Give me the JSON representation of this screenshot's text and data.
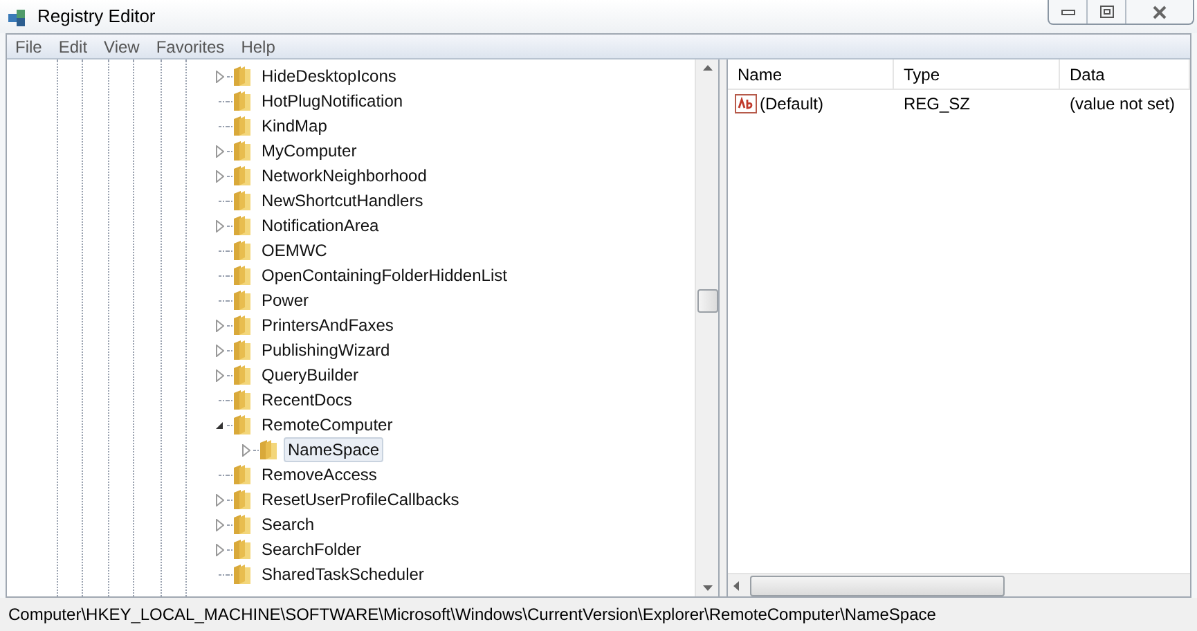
{
  "window": {
    "title": "Registry Editor"
  },
  "menu": [
    "File",
    "Edit",
    "View",
    "Favorites",
    "Help"
  ],
  "tree": [
    {
      "label": "HideDesktopIcons",
      "kind": "collapsed",
      "selected": false
    },
    {
      "label": "HotPlugNotification",
      "kind": "leaf",
      "selected": false
    },
    {
      "label": "KindMap",
      "kind": "leaf",
      "selected": false
    },
    {
      "label": "MyComputer",
      "kind": "collapsed",
      "selected": false
    },
    {
      "label": "NetworkNeighborhood",
      "kind": "collapsed",
      "selected": false
    },
    {
      "label": "NewShortcutHandlers",
      "kind": "leaf",
      "selected": false
    },
    {
      "label": "NotificationArea",
      "kind": "collapsed",
      "selected": false
    },
    {
      "label": "OEMWC",
      "kind": "leaf",
      "selected": false
    },
    {
      "label": "OpenContainingFolderHiddenList",
      "kind": "leaf",
      "selected": false
    },
    {
      "label": "Power",
      "kind": "leaf",
      "selected": false
    },
    {
      "label": "PrintersAndFaxes",
      "kind": "collapsed",
      "selected": false
    },
    {
      "label": "PublishingWizard",
      "kind": "collapsed",
      "selected": false
    },
    {
      "label": "QueryBuilder",
      "kind": "collapsed",
      "selected": false
    },
    {
      "label": "RecentDocs",
      "kind": "leaf",
      "selected": false
    },
    {
      "label": "RemoteComputer",
      "kind": "expanded",
      "selected": false,
      "children": [
        {
          "label": "NameSpace",
          "kind": "collapsed",
          "selected": true
        }
      ]
    },
    {
      "label": "RemoveAccess",
      "kind": "leaf",
      "selected": false
    },
    {
      "label": "ResetUserProfileCallbacks",
      "kind": "collapsed",
      "selected": false
    },
    {
      "label": "Search",
      "kind": "collapsed",
      "selected": false
    },
    {
      "label": "SearchFolder",
      "kind": "collapsed",
      "selected": false
    },
    {
      "label": "SharedTaskScheduler",
      "kind": "leaf",
      "selected": false
    }
  ],
  "values": {
    "columns": [
      "Name",
      "Type",
      "Data"
    ],
    "rows": [
      {
        "name": "(Default)",
        "type": "REG_SZ",
        "data": "(value not set)"
      }
    ]
  },
  "status_bar": "Computer\\HKEY_LOCAL_MACHINE\\SOFTWARE\\Microsoft\\Windows\\CurrentVersion\\Explorer\\RemoteComputer\\NameSpace"
}
